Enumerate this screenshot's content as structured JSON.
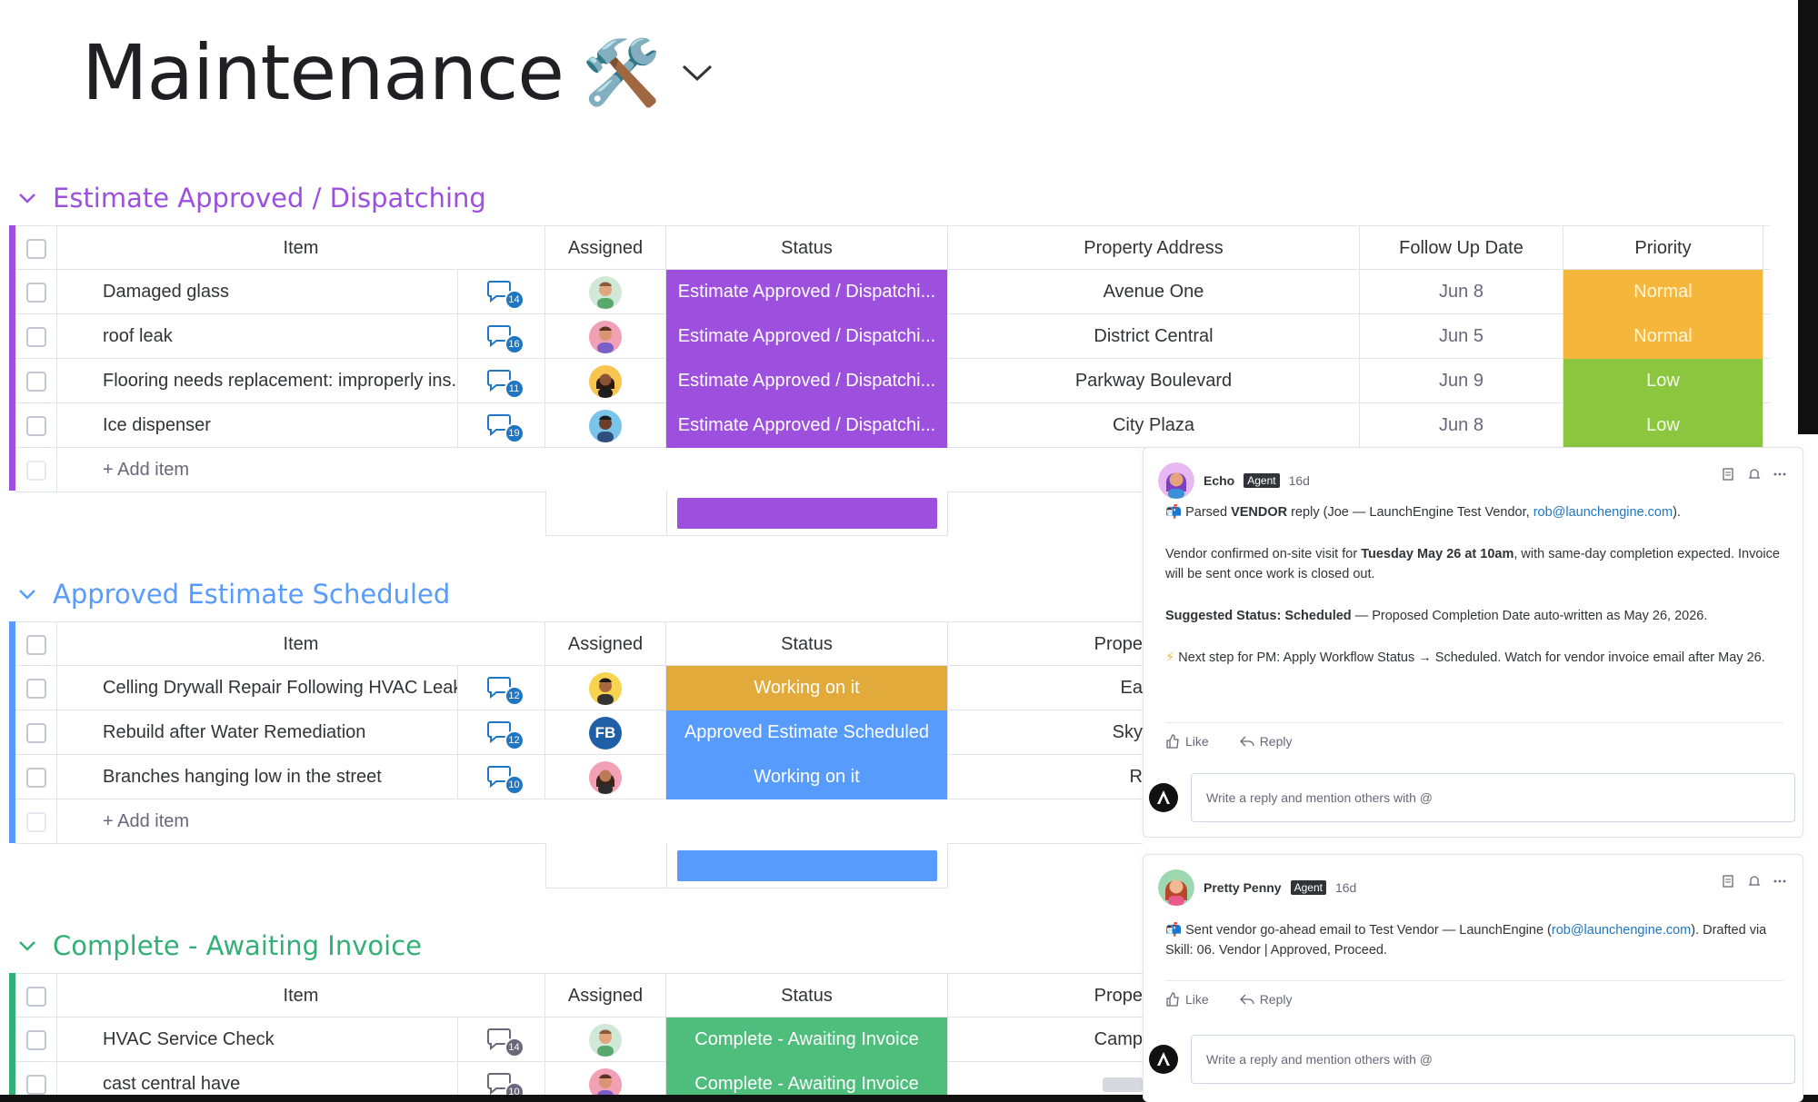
{
  "board": {
    "title": "Maintenance",
    "icon": "🛠️"
  },
  "columns": {
    "item": "Item",
    "assigned": "Assigned",
    "status": "Status",
    "property_address": "Property Address",
    "property_short": "Prope",
    "follow_up_date": "Follow Up Date",
    "priority": "Priority"
  },
  "add_item_label": "+ Add item",
  "groups": [
    {
      "title": "Estimate Approved / Dispatching",
      "color": "#9d50dd",
      "rows": [
        {
          "item": "Damaged glass",
          "updates": "14",
          "status": "Estimate Approved / Dispatchi...",
          "address": "Avenue One",
          "date": "Jun 8",
          "priority": "Normal"
        },
        {
          "item": "roof leak",
          "updates": "16",
          "status": "Estimate Approved / Dispatchi...",
          "address": "District Central",
          "date": "Jun 5",
          "priority": "Normal"
        },
        {
          "item": "Flooring needs replacement: improperly ins...",
          "updates": "11",
          "status": "Estimate Approved / Dispatchi...",
          "address": "Parkway Boulevard",
          "date": "Jun 9",
          "priority": "Low"
        },
        {
          "item": "Ice dispenser",
          "updates": "19",
          "status": "Estimate Approved / Dispatchi...",
          "address": "City Plaza",
          "date": "Jun 8",
          "priority": "Low"
        }
      ]
    },
    {
      "title": "Approved Estimate Scheduled",
      "color": "#579bfc",
      "rows": [
        {
          "item": "Celling Drywall Repair Following HVAC Leak",
          "updates": "12",
          "status": "Working on it",
          "address": "Ea"
        },
        {
          "item": "Rebuild after Water Remediation",
          "updates": "12",
          "assignee_initials": "FB",
          "status": "Approved Estimate Scheduled",
          "address": "Sky"
        },
        {
          "item": "Branches hanging low in the street",
          "updates": "10",
          "status": "Working on it",
          "address": "R"
        }
      ]
    },
    {
      "title": "Complete - Awaiting Invoice",
      "color": "#33b076",
      "rows": [
        {
          "item": "HVAC Service Check",
          "updates": "14",
          "status": "Complete - Awaiting Invoice",
          "address": "Camp"
        },
        {
          "item": "cast central have",
          "updates": "10",
          "status": "Complete - Awaiting Invoice",
          "address": ""
        }
      ]
    }
  ],
  "colors": {
    "status_purple": "#9d50dd",
    "status_orange": "#e2a93b",
    "status_blue": "#579bfc",
    "status_green": "#4fbd7c",
    "priority_normal": "#f5b73b",
    "priority_low": "#8cc63f"
  },
  "updates": [
    {
      "author": "Echo",
      "badge": "Agent",
      "time": "16d",
      "p1_prefix": "Parsed ",
      "p1_bold": "VENDOR",
      "p1_mid": " reply (Joe — LaunchEngine Test Vendor, ",
      "p1_link": "rob@launchengine.com",
      "p1_suffix": ").",
      "p2_prefix": "Vendor confirmed on-site visit for ",
      "p2_bold": "Tuesday May 26 at 10am",
      "p2_suffix": ", with same-day completion expected. Invoice will be sent once work is closed out.",
      "p3_bold": "Suggested Status: Scheduled",
      "p3_suffix": " — Proposed Completion Date auto-written as May 26, 2026.",
      "p4": "Next step for PM: Apply Workflow Status → Scheduled. Watch for vendor invoice email after May 26.",
      "like": "Like",
      "reply": "Reply",
      "reply_placeholder": "Write a reply and mention others with @"
    },
    {
      "author": "Pretty Penny",
      "badge": "Agent",
      "time": "16d",
      "p1_prefix": "Sent vendor go-ahead email to Test Vendor — LaunchEngine (",
      "p1_link": "rob@launchengine.com",
      "p1_suffix": "). Drafted via Skill: 06. Vendor | Approved, Proceed.",
      "like": "Like",
      "reply": "Reply",
      "reply_placeholder": "Write a reply and mention others with @"
    }
  ]
}
